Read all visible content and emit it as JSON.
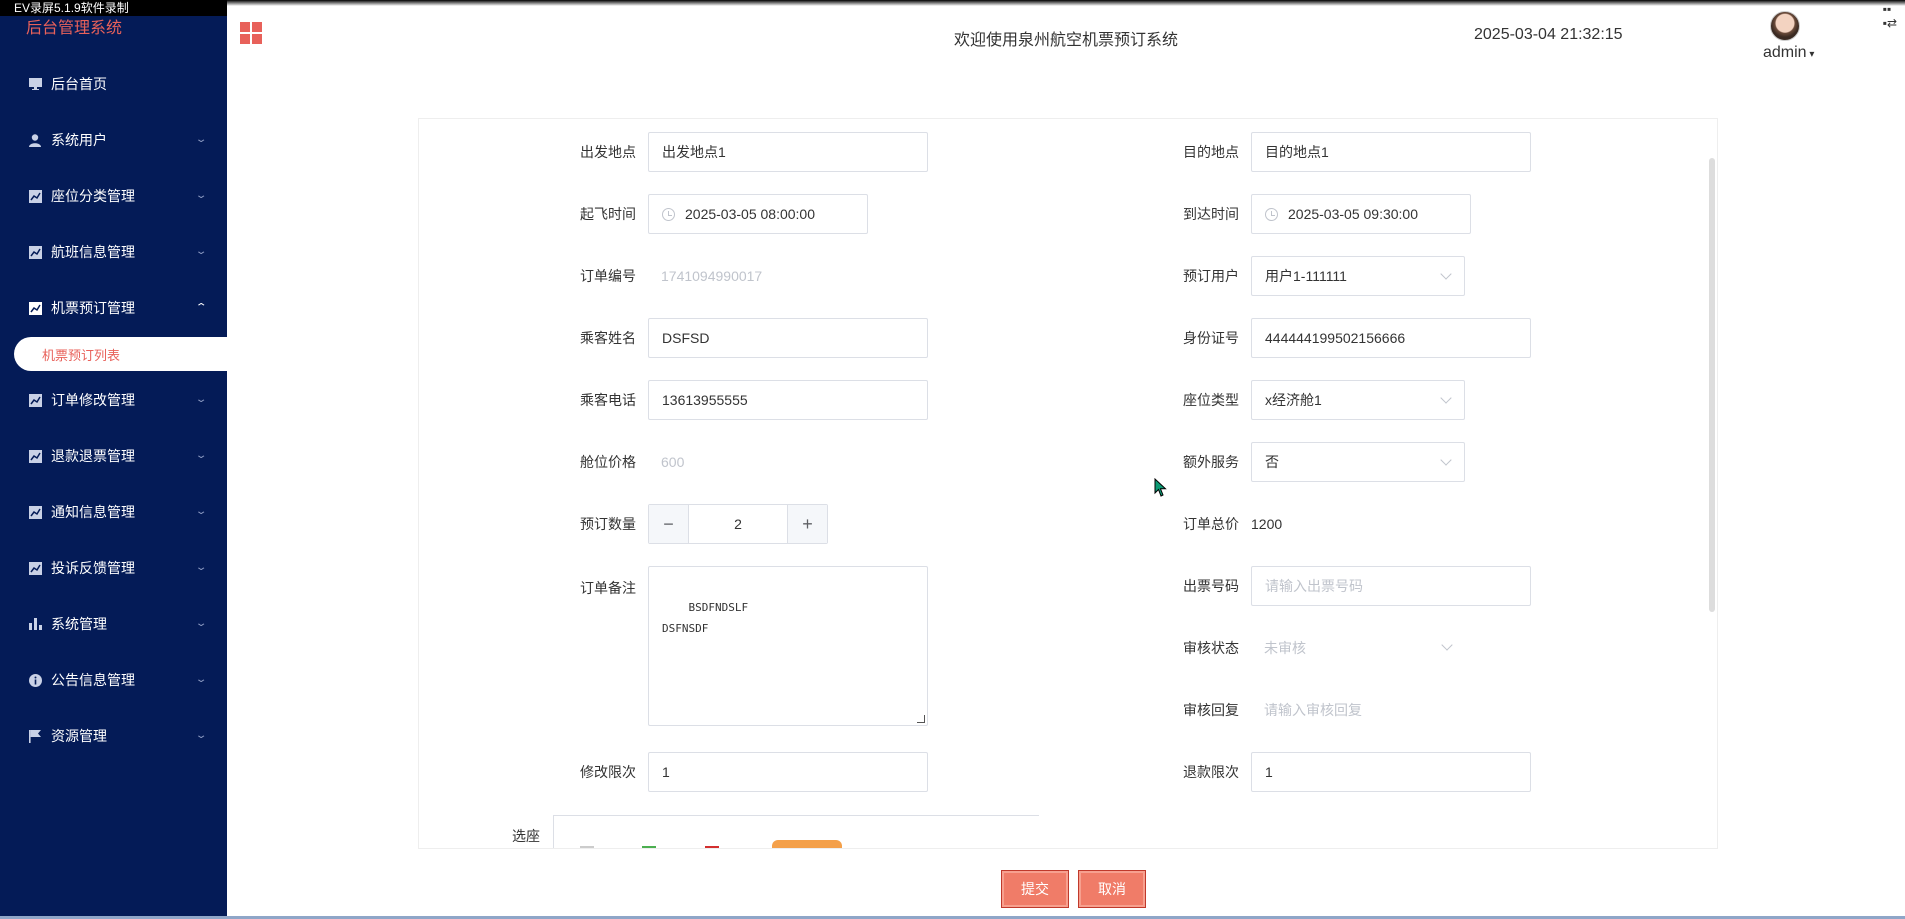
{
  "recorder_label": "EV录屏5.1.9软件录制",
  "sidebar": {
    "title": "后台管理系统",
    "items": [
      {
        "label": "后台首页",
        "icon": "monitor-icon"
      },
      {
        "label": "系统用户",
        "icon": "user-icon"
      },
      {
        "label": "座位分类管理",
        "icon": "chart-icon"
      },
      {
        "label": "航班信息管理",
        "icon": "chart-icon"
      },
      {
        "label": "机票预订管理",
        "icon": "chart-icon"
      },
      {
        "label": "订单修改管理",
        "icon": "chart-icon"
      },
      {
        "label": "退款退票管理",
        "icon": "chart-icon"
      },
      {
        "label": "通知信息管理",
        "icon": "chart-icon"
      },
      {
        "label": "投诉反馈管理",
        "icon": "chart-icon"
      },
      {
        "label": "系统管理",
        "icon": "bar-chart-icon"
      },
      {
        "label": "公告信息管理",
        "icon": "info-icon"
      },
      {
        "label": "资源管理",
        "icon": "flag-icon"
      }
    ],
    "active_sub": "机票预订列表"
  },
  "header": {
    "welcome": "欢迎使用泉州航空机票预订系统",
    "datetime": "2025-03-04 21:32:15",
    "user": "admin"
  },
  "form": {
    "departure": {
      "label": "出发地点",
      "value": "出发地点1"
    },
    "destination": {
      "label": "目的地点",
      "value": "目的地点1"
    },
    "takeoff": {
      "label": "起飞时间",
      "value": "2025-03-05 08:00:00"
    },
    "arrival": {
      "label": "到达时间",
      "value": "2025-03-05 09:30:00"
    },
    "order_no": {
      "label": "订单编号",
      "value": "1741094990017"
    },
    "booking_user": {
      "label": "预订用户",
      "value": "用户1-111111"
    },
    "passenger_name": {
      "label": "乘客姓名",
      "value": "DSFSD"
    },
    "id_number": {
      "label": "身份证号",
      "value": "444444199502156666"
    },
    "passenger_phone": {
      "label": "乘客电话",
      "value": "13613955555"
    },
    "seat_type": {
      "label": "座位类型",
      "value": "x经济舱1"
    },
    "cabin_price": {
      "label": "舱位价格",
      "value": "600"
    },
    "extra_service": {
      "label": "额外服务",
      "value": "否"
    },
    "quantity": {
      "label": "预订数量",
      "value": "2",
      "minus": "−",
      "plus": "+"
    },
    "order_total": {
      "label": "订单总价",
      "value": "1200"
    },
    "remark": {
      "label": "订单备注",
      "value": "BSDFNDSLF\nDSFNSDF"
    },
    "ticket_no": {
      "label": "出票号码",
      "placeholder": "请输入出票号码"
    },
    "review_status": {
      "label": "审核状态",
      "value": "未审核"
    },
    "review_reply": {
      "label": "审核回复",
      "placeholder": "请输入审核回复"
    },
    "modify_limit": {
      "label": "修改限次",
      "value": "1"
    },
    "refund_limit": {
      "label": "退款限次",
      "value": "1"
    },
    "seat_select": {
      "label": "选座"
    }
  },
  "buttons": {
    "submit": "提交",
    "cancel": "取消"
  },
  "colors": {
    "sidebar_bg": "#041b57",
    "accent": "#e8615a",
    "button": "#f07c68"
  }
}
